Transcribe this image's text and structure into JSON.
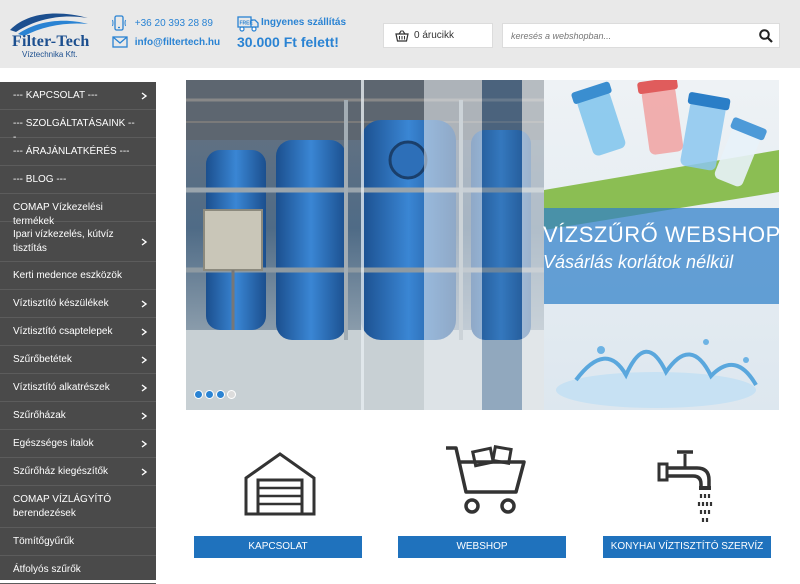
{
  "header": {
    "logo_text": "Filter-Tech",
    "logo_sub": "Víztechnika Kft.",
    "phone": "+36 20 393 28 89",
    "email": "info@filtertech.hu",
    "shipping_line1": "Ingyenes szállítás",
    "shipping_line2": "30.000 Ft felett!",
    "shipping_badge": "FREE",
    "cart_label": "0 árucikk",
    "search_placeholder": "keresés a webshopban..."
  },
  "sidebar": {
    "items": [
      {
        "label": "--- KAPCSOLAT ---",
        "chevron": true
      },
      {
        "label": "--- SZOLGÁLTATÁSAINK ---",
        "chevron": false
      },
      {
        "label": "--- ÁRAJÁNLATKÉRÉS ---",
        "chevron": false
      },
      {
        "label": "--- BLOG ---",
        "chevron": false
      },
      {
        "label": "COMAP Vízkezelési termékek",
        "chevron": false
      },
      {
        "label": "Ipari vízkezelés, kútvíz tisztítás",
        "chevron": true
      },
      {
        "label": "Kerti medence eszközök",
        "chevron": false
      },
      {
        "label": "Víztisztító készülékek",
        "chevron": true
      },
      {
        "label": "Víztisztító csaptelepek",
        "chevron": true
      },
      {
        "label": "Szűrőbetétek",
        "chevron": true
      },
      {
        "label": "Víztisztító alkatrészek",
        "chevron": true
      },
      {
        "label": "Szűrőházak",
        "chevron": true
      },
      {
        "label": "Egészséges italok",
        "chevron": true
      },
      {
        "label": "Szűrőház kiegészítők",
        "chevron": true
      },
      {
        "label": "COMAP VÍZLÁGYÍTÓ berendezések",
        "chevron": false
      },
      {
        "label": "Tömítőgyűrűk",
        "chevron": false
      },
      {
        "label": "Átfolyós szűrők",
        "chevron": false
      }
    ]
  },
  "slider": {
    "title": "VÍZSZŰRŐ WEBSHOP",
    "subtitle": "Vásárlás korlátok nélkül",
    "active_slide": 3,
    "slide_count": 4
  },
  "features": [
    {
      "icon": "garage-icon",
      "label": "KAPCSOLAT"
    },
    {
      "icon": "shopping-cart-icon",
      "label": "WEBSHOP"
    },
    {
      "icon": "faucet-icon",
      "label": "KONYHAI VÍZTISZTÍTÓ SZERVÍZ"
    }
  ],
  "colors": {
    "accent": "#2a83d3",
    "brand": "#1c4f8f",
    "button": "#1f72bd",
    "sidebar": "#4a4a4a",
    "header_bg": "#e9e9e9"
  }
}
